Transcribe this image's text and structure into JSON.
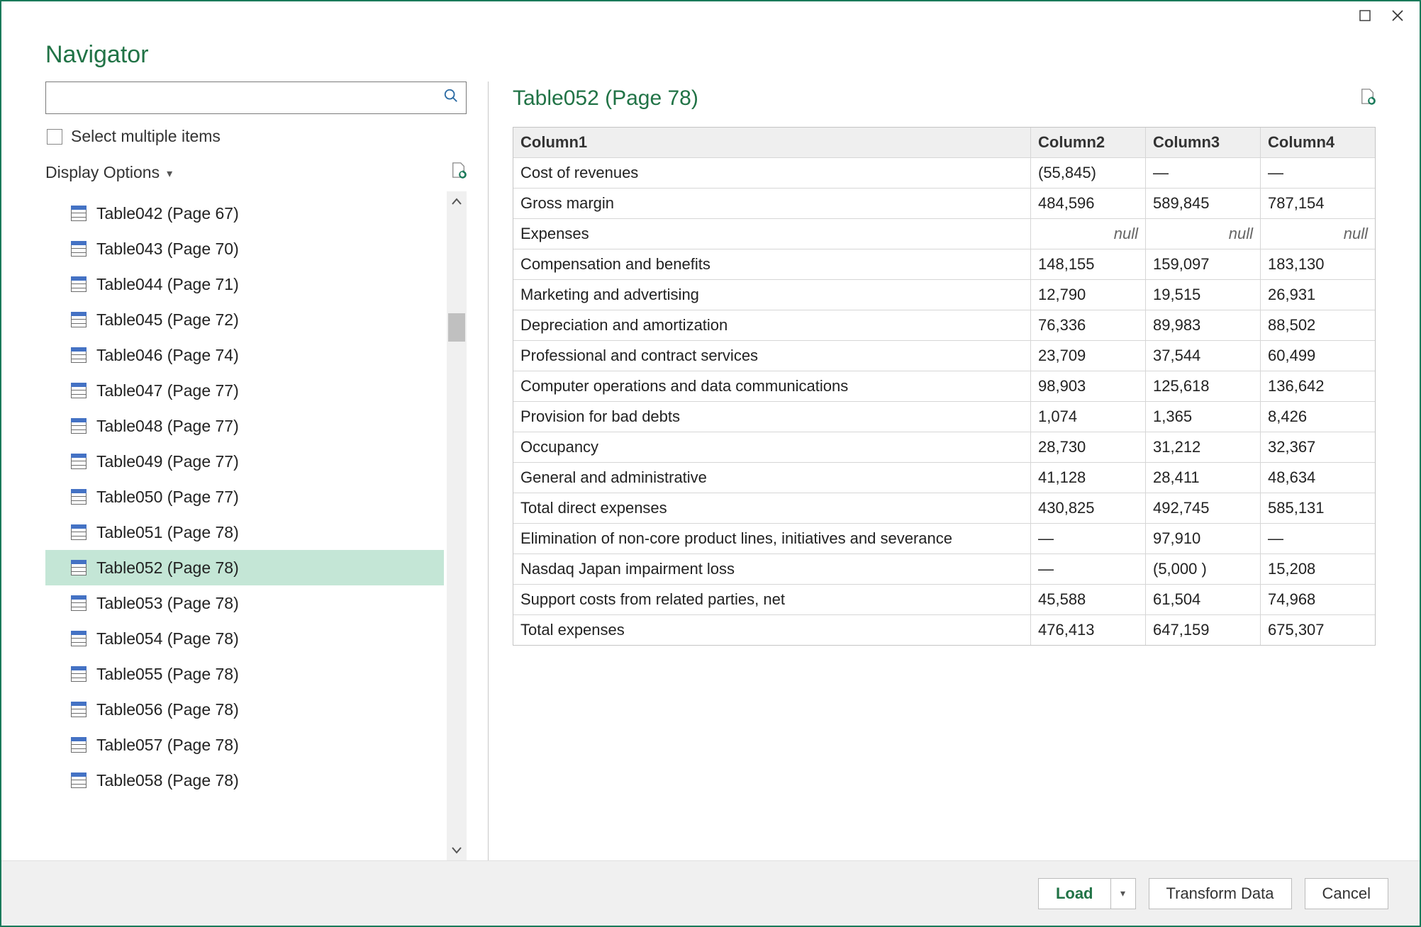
{
  "dialog": {
    "title": "Navigator"
  },
  "left": {
    "select_multiple_label": "Select multiple items",
    "display_options_label": "Display Options",
    "search_placeholder": "",
    "selected_index": 10,
    "items": [
      {
        "label": "Table042 (Page 67)"
      },
      {
        "label": "Table043 (Page 70)"
      },
      {
        "label": "Table044 (Page 71)"
      },
      {
        "label": "Table045 (Page 72)"
      },
      {
        "label": "Table046 (Page 74)"
      },
      {
        "label": "Table047 (Page 77)"
      },
      {
        "label": "Table048 (Page 77)"
      },
      {
        "label": "Table049 (Page 77)"
      },
      {
        "label": "Table050 (Page 77)"
      },
      {
        "label": "Table051 (Page 78)"
      },
      {
        "label": "Table052 (Page 78)"
      },
      {
        "label": "Table053 (Page 78)"
      },
      {
        "label": "Table054 (Page 78)"
      },
      {
        "label": "Table055 (Page 78)"
      },
      {
        "label": "Table056 (Page 78)"
      },
      {
        "label": "Table057 (Page 78)"
      },
      {
        "label": "Table058 (Page 78)"
      }
    ]
  },
  "preview": {
    "title": "Table052 (Page 78)",
    "columns": [
      "Column1",
      "Column2",
      "Column3",
      "Column4"
    ],
    "rows": [
      [
        "Cost of revenues",
        "(55,845)",
        "—",
        "—"
      ],
      [
        "Gross margin",
        "484,596",
        "589,845",
        "787,154"
      ],
      [
        "Expenses",
        null,
        null,
        null
      ],
      [
        "Compensation and benefits",
        "148,155",
        "159,097",
        "183,130"
      ],
      [
        "Marketing and advertising",
        "12,790",
        "19,515",
        "26,931"
      ],
      [
        "Depreciation and amortization",
        "76,336",
        "89,983",
        "88,502"
      ],
      [
        "Professional and contract services",
        "23,709",
        "37,544",
        "60,499"
      ],
      [
        "Computer operations and data communications",
        "98,903",
        "125,618",
        "136,642"
      ],
      [
        "Provision for bad debts",
        "1,074",
        "1,365",
        "8,426"
      ],
      [
        "Occupancy",
        "28,730",
        "31,212",
        "32,367"
      ],
      [
        "General and administrative",
        "41,128",
        "28,411",
        "48,634"
      ],
      [
        "Total direct expenses",
        "430,825",
        "492,745",
        "585,131"
      ],
      [
        "Elimination of non-core product lines, initiatives and severance",
        "—",
        "97,910",
        "—"
      ],
      [
        "Nasdaq Japan impairment loss",
        "—",
        "(5,000 )",
        "15,208"
      ],
      [
        "Support costs from related parties, net",
        "45,588",
        "61,504",
        "74,968"
      ],
      [
        "Total expenses",
        "476,413",
        "647,159",
        "675,307"
      ]
    ]
  },
  "footer": {
    "load_label": "Load",
    "transform_label": "Transform Data",
    "cancel_label": "Cancel"
  }
}
